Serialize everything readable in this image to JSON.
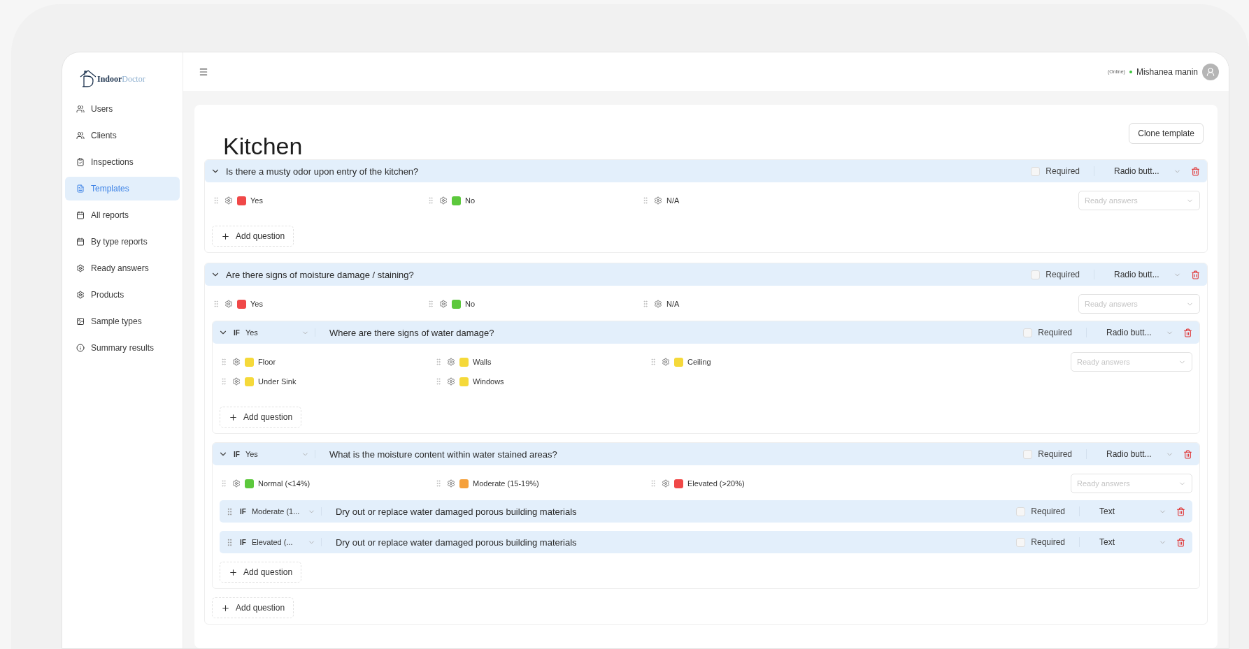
{
  "logo": {
    "first": "Indoor",
    "second": "Doctor"
  },
  "sidebar": {
    "items": [
      {
        "label": "Users",
        "selected": false
      },
      {
        "label": "Clients",
        "selected": false
      },
      {
        "label": "Inspections",
        "selected": false
      },
      {
        "label": "Templates",
        "selected": true
      },
      {
        "label": "All reports",
        "selected": false
      },
      {
        "label": "By type reports",
        "selected": false
      },
      {
        "label": "Ready answers",
        "selected": false
      },
      {
        "label": "Products",
        "selected": false
      },
      {
        "label": "Sample types",
        "selected": false
      },
      {
        "label": "Summary results",
        "selected": false
      }
    ]
  },
  "header": {
    "status": "(Online)",
    "online": true,
    "user": "Mishanea manin"
  },
  "page": {
    "title": "Kitchen",
    "clone_button": "Clone template"
  },
  "questions": [
    {
      "kind": "choice",
      "expanded": true,
      "title": "Is there a musty odor upon entry of the kitchen?",
      "required": false,
      "required_label": "Required",
      "type": "Radio butt...",
      "ready_answers": "Ready answers",
      "add_button": "Add question",
      "answers": [
        {
          "label": "Yes",
          "color": "#f04848"
        },
        {
          "label": "No",
          "color": "#5cc83c"
        },
        {
          "label": "N/A"
        }
      ]
    },
    {
      "kind": "choice",
      "expanded": true,
      "title": "Are there signs of moisture damage / staining?",
      "required": false,
      "required_label": "Required",
      "type": "Radio butt...",
      "ready_answers": "Ready answers",
      "answers": [
        {
          "label": "Yes",
          "color": "#f04848"
        },
        {
          "label": "No",
          "color": "#5cc83c"
        },
        {
          "label": "N/A"
        }
      ],
      "children": [
        {
          "kind": "choice",
          "expanded": true,
          "condition": {
            "label": "IF",
            "value": "Yes"
          },
          "title": "Where are there signs of water damage?",
          "required": false,
          "required_label": "Required",
          "type": "Radio butt...",
          "ready_answers": "Ready answers",
          "add_button": "Add question",
          "answers": [
            {
              "label": "Floor",
              "color": "#f5d93a"
            },
            {
              "label": "Walls",
              "color": "#f5d93a"
            },
            {
              "label": "Ceiling",
              "color": "#f5d93a"
            },
            {
              "label": "Under Sink",
              "color": "#f5d93a"
            },
            {
              "label": "Windows",
              "color": "#f5d93a"
            }
          ]
        },
        {
          "kind": "choice",
          "expanded": true,
          "condition": {
            "label": "IF",
            "value": "Yes"
          },
          "title": "What is the moisture content within water stained areas?",
          "required": false,
          "required_label": "Required",
          "type": "Radio butt...",
          "ready_answers": "Ready answers",
          "add_button": "Add question",
          "answers": [
            {
              "label": "Normal (<14%)",
              "color": "#5cc83c"
            },
            {
              "label": "Moderate (15-19%)",
              "color": "#f5a03a"
            },
            {
              "label": "Elevated (>20%)",
              "color": "#f04848"
            }
          ],
          "children": [
            {
              "kind": "text",
              "condition": {
                "label": "IF",
                "value": "Moderate (1..."
              },
              "title": "Dry out or replace water damaged porous building materials",
              "required": false,
              "required_label": "Required",
              "type": "Text"
            },
            {
              "kind": "text",
              "condition": {
                "label": "IF",
                "value": "Elevated (..."
              },
              "title": "Dry out or replace water damaged porous building materials",
              "required": false,
              "required_label": "Required",
              "type": "Text"
            }
          ]
        }
      ],
      "add_button": "Add question"
    }
  ]
}
